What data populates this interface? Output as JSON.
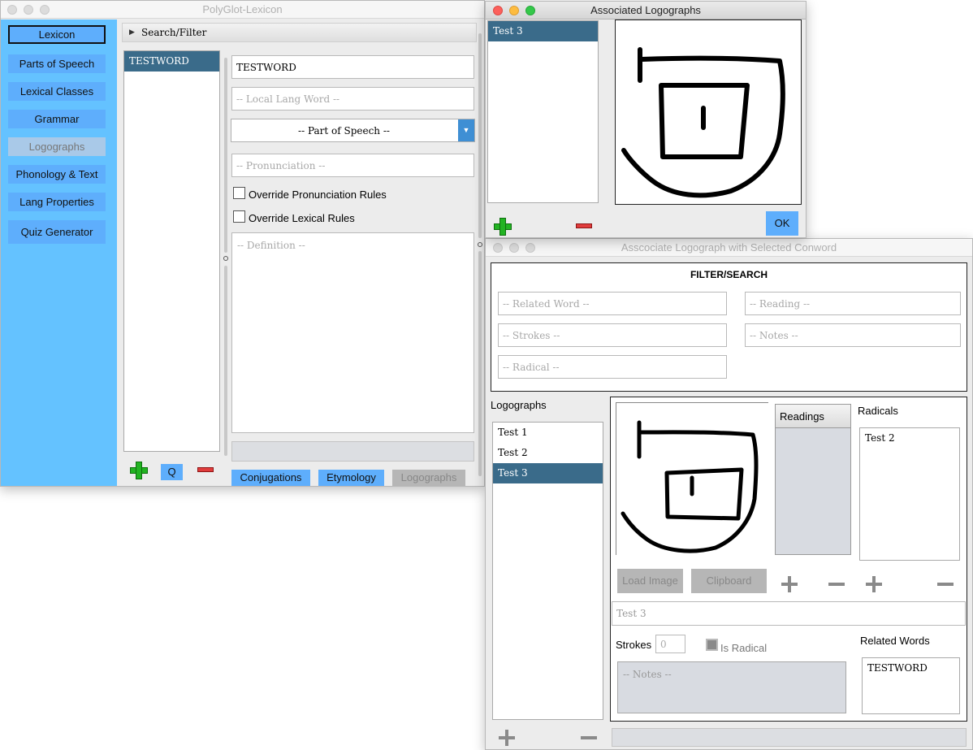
{
  "main_window": {
    "title": "PolyGlot-Lexicon",
    "nav": [
      "Lexicon",
      "Parts of Speech",
      "Lexical Classes",
      "Grammar",
      "Logographs",
      "Phonology & Text",
      "Lang Properties",
      "Quiz Generator"
    ],
    "search_filter_label": "Search/Filter",
    "word_list": [
      "TESTWORD"
    ],
    "conword_value": "TESTWORD",
    "local_word_placeholder": "-- Local Lang Word --",
    "part_of_speech_value": "-- Part of Speech --",
    "pronunciation_placeholder": "-- Pronunciation --",
    "override_pronunciation_label": "Override Pronunciation Rules",
    "override_lexical_label": "Override Lexical Rules",
    "definition_placeholder": "-- Definition --",
    "q_button_label": "Q",
    "bottom_tabs": [
      "Conjugations",
      "Etymology",
      "Logographs"
    ]
  },
  "associated_window": {
    "title": "Associated Logographs",
    "list": [
      "Test 3"
    ],
    "ok_label": "OK"
  },
  "associate_window": {
    "title": "Asscociate Logograph with Selected Conword",
    "filter_title": "FILTER/SEARCH",
    "related_word_placeholder": "-- Related Word --",
    "reading_placeholder": "-- Reading --",
    "strokes_placeholder": "-- Strokes --",
    "notes_filter_placeholder": "-- Notes --",
    "radical_placeholder": "-- Radical --",
    "logographs_label": "Logographs",
    "logograph_list": [
      "Test 1",
      "Test 2",
      "Test 3"
    ],
    "readings_header": "Readings",
    "radicals_label": "Radicals",
    "radicals_list": [
      "Test 2"
    ],
    "load_image_label": "Load Image",
    "clipboard_label": "Clipboard",
    "name_value": "Test 3",
    "strokes_label": "Strokes",
    "strokes_value": "0",
    "is_radical_label": "Is Radical",
    "related_words_label": "Related Words",
    "related_words_list": [
      "TESTWORD"
    ],
    "notes_placeholder": "-- Notes --"
  },
  "colors": {
    "sidebar": "#64c2ff",
    "accent_button": "#5eaefc",
    "selection": "#3a6b8a",
    "add_green": "#22b322",
    "remove_red": "#e03c3c"
  }
}
